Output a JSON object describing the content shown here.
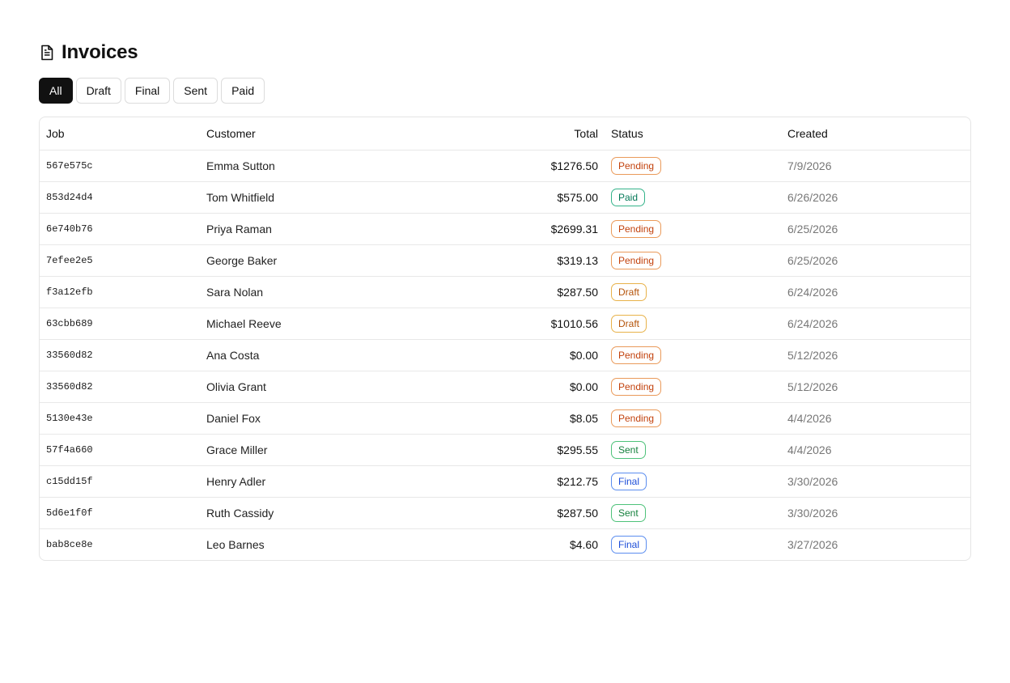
{
  "header": {
    "icon": "document-icon",
    "title": "Invoices"
  },
  "filters": [
    {
      "label": "All",
      "active": true
    },
    {
      "label": "Draft",
      "active": false
    },
    {
      "label": "Final",
      "active": false
    },
    {
      "label": "Sent",
      "active": false
    },
    {
      "label": "Paid",
      "active": false
    }
  ],
  "table": {
    "columns": {
      "job": "Job",
      "customer": "Customer",
      "total": "Total",
      "status": "Status",
      "created": "Created"
    },
    "rows": [
      {
        "job": "567e575c",
        "customer": "Emma Sutton",
        "total": "$1276.50",
        "status": "Pending",
        "status_kind": "pending",
        "created": "7/9/2026"
      },
      {
        "job": "853d24d4",
        "customer": "Tom Whitfield",
        "total": "$575.00",
        "status": "Paid",
        "status_kind": "paid",
        "created": "6/26/2026"
      },
      {
        "job": "6e740b76",
        "customer": "Priya Raman",
        "total": "$2699.31",
        "status": "Pending",
        "status_kind": "pending",
        "created": "6/25/2026"
      },
      {
        "job": "7efee2e5",
        "customer": "George Baker",
        "total": "$319.13",
        "status": "Pending",
        "status_kind": "pending",
        "created": "6/25/2026"
      },
      {
        "job": "f3a12efb",
        "customer": "Sara Nolan",
        "total": "$287.50",
        "status": "Draft",
        "status_kind": "draft",
        "created": "6/24/2026"
      },
      {
        "job": "63cbb689",
        "customer": "Michael Reeve",
        "total": "$1010.56",
        "status": "Draft",
        "status_kind": "draft",
        "created": "6/24/2026"
      },
      {
        "job": "33560d82",
        "customer": "Ana Costa",
        "total": "$0.00",
        "status": "Pending",
        "status_kind": "pending",
        "created": "5/12/2026"
      },
      {
        "job": "33560d82",
        "customer": "Olivia Grant",
        "total": "$0.00",
        "status": "Pending",
        "status_kind": "pending",
        "created": "5/12/2026"
      },
      {
        "job": "5130e43e",
        "customer": "Daniel Fox",
        "total": "$8.05",
        "status": "Pending",
        "status_kind": "pending",
        "created": "4/4/2026"
      },
      {
        "job": "57f4a660",
        "customer": "Grace Miller",
        "total": "$295.55",
        "status": "Sent",
        "status_kind": "sent",
        "created": "4/4/2026"
      },
      {
        "job": "c15dd15f",
        "customer": "Henry Adler",
        "total": "$212.75",
        "status": "Final",
        "status_kind": "final",
        "created": "3/30/2026"
      },
      {
        "job": "5d6e1f0f",
        "customer": "Ruth Cassidy",
        "total": "$287.50",
        "status": "Sent",
        "status_kind": "sent",
        "created": "3/30/2026"
      },
      {
        "job": "bab8ce8e",
        "customer": "Leo Barnes",
        "total": "$4.60",
        "status": "Final",
        "status_kind": "final",
        "created": "3/27/2026"
      }
    ]
  },
  "colors": {
    "active_filter_bg": "#111111",
    "pending": "#c2410c",
    "paid": "#047857",
    "draft": "#b45309",
    "sent": "#15803d",
    "final": "#1d4ed8"
  }
}
